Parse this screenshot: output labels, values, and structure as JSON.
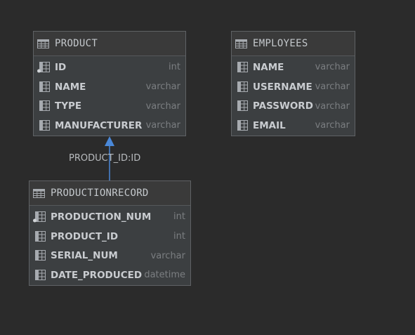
{
  "tables": {
    "product": {
      "title": "PRODUCT",
      "columns": [
        {
          "name": "ID",
          "type": "int",
          "key": true
        },
        {
          "name": "NAME",
          "type": "varchar",
          "key": false
        },
        {
          "name": "TYPE",
          "type": "varchar",
          "key": false
        },
        {
          "name": "MANUFACTURER",
          "type": "varchar",
          "key": false
        }
      ]
    },
    "employees": {
      "title": "EMPLOYEES",
      "columns": [
        {
          "name": "NAME",
          "type": "varchar",
          "key": false
        },
        {
          "name": "USERNAME",
          "type": "varchar",
          "key": false
        },
        {
          "name": "PASSWORD",
          "type": "varchar",
          "key": false
        },
        {
          "name": "EMAIL",
          "type": "varchar",
          "key": false
        }
      ]
    },
    "productionrecord": {
      "title": "PRODUCTIONRECORD",
      "columns": [
        {
          "name": "PRODUCTION_NUM",
          "type": "int",
          "key": true
        },
        {
          "name": "PRODUCT_ID",
          "type": "int",
          "key": false
        },
        {
          "name": "SERIAL_NUM",
          "type": "varchar",
          "key": false
        },
        {
          "name": "DATE_PRODUCED",
          "type": "datetime",
          "key": false
        }
      ]
    }
  },
  "relation": {
    "label": "PRODUCT_ID:ID",
    "color": "#4a88d8"
  },
  "icons": {
    "table": "table-icon",
    "column": "column-icon",
    "key_column": "key-column-icon"
  }
}
